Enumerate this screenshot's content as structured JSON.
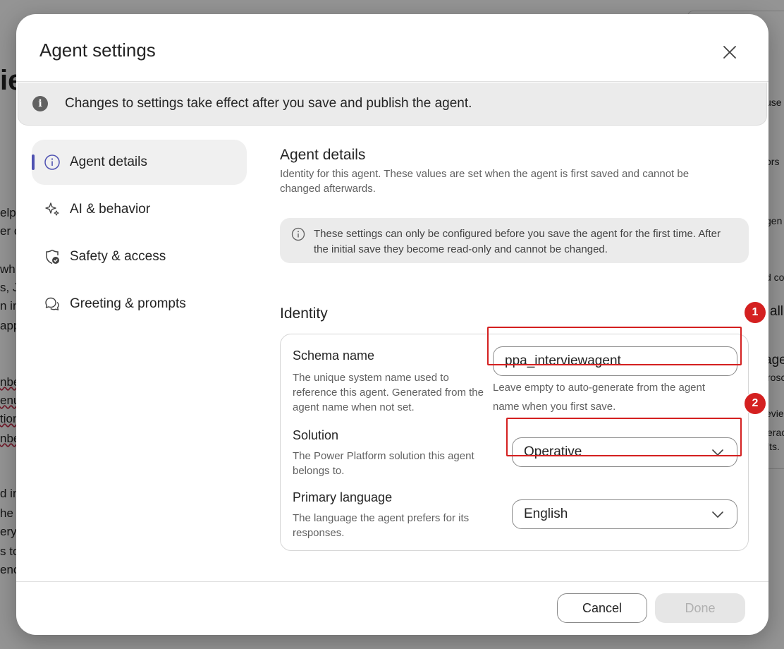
{
  "background": {
    "fragments": [
      {
        "text": "ie",
        "cls": "big"
      },
      {
        "text": "elp",
        "cls": ""
      },
      {
        "text": "er c",
        "cls": ""
      },
      {
        "text": "wh",
        "cls": ""
      },
      {
        "text": "s, J",
        "cls": ""
      },
      {
        "text": "n int",
        "cls": ""
      },
      {
        "text": "app",
        "cls": ""
      },
      {
        "text": "nbe",
        "cls": "wavy"
      },
      {
        "text": "enu",
        "cls": "wavy"
      },
      {
        "text": "tion",
        "cls": "wavy"
      },
      {
        "text": "nbe",
        "cls": "wavy"
      },
      {
        "text": "d in",
        "cls": ""
      },
      {
        "text": "he c",
        "cls": ""
      },
      {
        "text": "ery",
        "cls": ""
      },
      {
        "text": "s to",
        "cls": ""
      },
      {
        "text": "enc",
        "cls": ""
      },
      {
        "text": "use",
        "cls": ""
      },
      {
        "text": "ors",
        "cls": ""
      },
      {
        "text": "gen",
        "cls": ""
      },
      {
        "text": "d co",
        "cls": ""
      },
      {
        "text": "all",
        "cls": ""
      },
      {
        "text": "age",
        "cls": ""
      },
      {
        "text": "rosc",
        "cls": ""
      },
      {
        "text": "evie",
        "cls": ""
      },
      {
        "text": "erac",
        "cls": ""
      },
      {
        "text": "lts.",
        "cls": ""
      }
    ]
  },
  "dialog": {
    "title": "Agent settings",
    "close_icon": "close-icon",
    "banner": {
      "icon": "info-filled-icon",
      "text": "Changes to settings take effect after you save and publish the agent."
    },
    "nav": [
      {
        "label": "Agent details",
        "icon": "info-icon",
        "active": true
      },
      {
        "label": "AI & behavior",
        "icon": "sparkle-icon",
        "active": false
      },
      {
        "label": "Safety & access",
        "icon": "shield-check-icon",
        "active": false
      },
      {
        "label": "Greeting & prompts",
        "icon": "chat-bubbles-icon",
        "active": false
      }
    ],
    "section": {
      "title": "Agent details",
      "description": "Identity for this agent. These values are set when the agent is first saved and cannot be changed afterwards.",
      "notice": "These settings can only be configured before you save the agent for the first time. After the initial save they become read-only and cannot be changed.",
      "identity_title": "Identity"
    },
    "fields": {
      "schema": {
        "label": "Schema name",
        "description": "The unique system name used to reference this agent. Generated from the agent name when not set.",
        "value": "ppa_interviewagent",
        "helper": "Leave empty to auto-generate from the agent name when you first save."
      },
      "solution": {
        "label": "Solution",
        "description": "The Power Platform solution this agent belongs to.",
        "value": "Operative"
      },
      "language": {
        "label": "Primary language",
        "description": "The language the agent prefers for its responses.",
        "value": "English"
      }
    },
    "markers": [
      "1",
      "2"
    ],
    "footer": {
      "cancel_label": "Cancel",
      "done_label": "Done"
    },
    "colors": {
      "accent": "#4f52b2",
      "highlight": "#d42020",
      "banner_bg": "#ebebeb"
    }
  }
}
